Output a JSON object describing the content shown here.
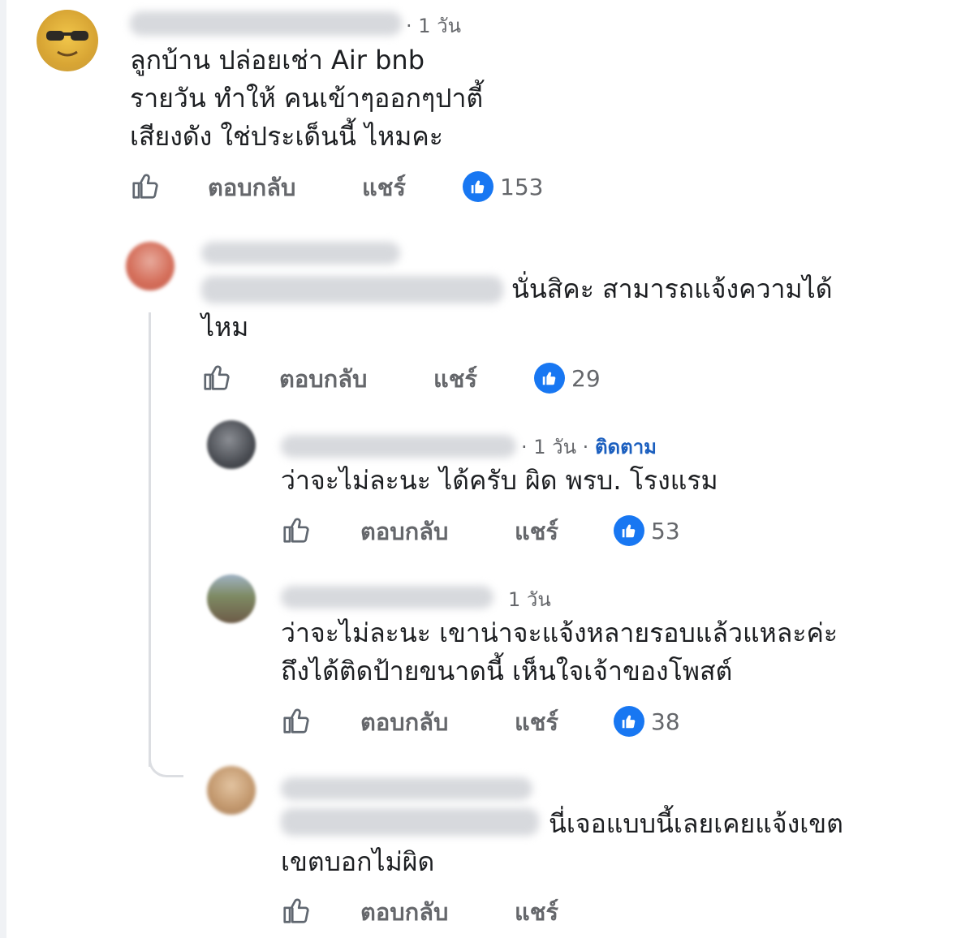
{
  "comments": [
    {
      "time": "· 1 วัน",
      "lines": [
        "ลูกบ้าน ปล่อยเช่า Air bnb",
        "รายวัน ทำให้ คนเข้าๆออกๆปาตี้",
        "เสียงดัง ใช่ประเด็นนี้ ไหมคะ"
      ],
      "reply": "ตอบกลับ",
      "share": "แชร์",
      "likes": "153"
    },
    {
      "lines": [
        "นั่นสิคะ สามารถแจ้งความได้",
        "ไหม"
      ],
      "reply": "ตอบกลับ",
      "share": "แชร์",
      "likes": "29"
    },
    {
      "time": "· 1 วัน ·",
      "follow": "ติดตาม",
      "lines": [
        "ว่าจะไม่ละนะ ได้ครับ ผิด พรบ. โรงแรม"
      ],
      "reply": "ตอบกลับ",
      "share": "แชร์",
      "likes": "53"
    },
    {
      "time": "1 วัน",
      "lines": [
        "ว่าจะไม่ละนะ เขาน่าจะแจ้งหลายรอบแล้วแหละค่ะ",
        "ถึงได้ติดป้ายขนาดนี้ เห็นใจเจ้าของโพสต์"
      ],
      "reply": "ตอบกลับ",
      "share": "แชร์",
      "likes": "38"
    },
    {
      "lines": [
        "นี่เจอแบบนี้เลยเคยแจ้งเขต",
        "เขตบอกไม่ผิด"
      ],
      "reply": "ตอบกลับ",
      "share": "แชร์"
    }
  ],
  "colors": {
    "like_blue": "#1877f2",
    "follow_blue": "#1b5fbf",
    "secondary_text": "#65676b",
    "thread_line": "#dcdee2"
  },
  "icons": {
    "like_outline": "thumbs-up-icon",
    "reaction": "like-reaction-icon"
  }
}
